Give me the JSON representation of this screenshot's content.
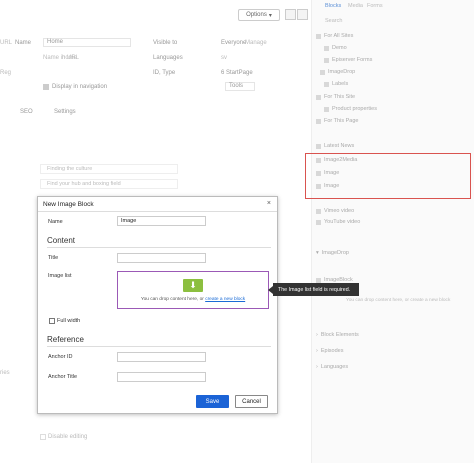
{
  "background": {
    "options_label": "Options",
    "fields": {
      "name_label": "Name",
      "name_value": "Home",
      "name_url_label": "Name in URL",
      "name_url_value": "home",
      "visible_label": "Visible to",
      "visible_value": "Everyone",
      "visible_link": "Manage",
      "languages_label": "Languages",
      "languages_value": "sv",
      "id_type_label": "ID, Type",
      "id_type_value": "6 StartPage",
      "display_nav_label": "Display in navigation",
      "tools_label": "Tools",
      "seo_tab": "SEO",
      "settings_tab": "Settings"
    },
    "cards": [
      "Finding the culture",
      "Find your hub and boxing field"
    ],
    "partial_left_1": "URL",
    "partial_left_2": "Reg",
    "partial_left_3": "ries",
    "bottom_checkbox_label": "Disable editing"
  },
  "right_panel": {
    "tabs": [
      "Blocks",
      "Media",
      "Forms"
    ],
    "search_placeholder": "Search",
    "tree": [
      "For All Sites",
      "Demo",
      "Episerver Forms",
      "ImageDrop",
      "Labels",
      "For This Site",
      "Product properties",
      "For This Page"
    ],
    "list_a": [
      "Latest News",
      "Image2Media",
      "Image",
      "Image"
    ],
    "list_b": [
      "Vimeo video",
      "YouTube video"
    ],
    "imagedrop_header": "ImageDrop",
    "imagedrop_item": "ImageBlock",
    "drop_hint": "You can drop content here, or create a new block",
    "sections": [
      "Block Elements",
      "Episodes",
      "Languages"
    ]
  },
  "modal": {
    "title": "New Image Block",
    "close_icon": "×",
    "name_label": "Name",
    "name_value": "Image",
    "content_heading": "Content",
    "title_label": "Title",
    "image_list_label": "Image list",
    "drop_text_prefix": "You can drop content here, or ",
    "drop_link": "create a new block",
    "full_width_label": "Full width",
    "reference_heading": "Reference",
    "anchor_id_label": "Anchor ID",
    "anchor_title_label": "Anchor Title",
    "save_label": "Save",
    "cancel_label": "Cancel"
  },
  "tooltip": "The Image list field is required.",
  "colors": {
    "primary": "#1b63d6",
    "dropzone_border": "#9b59b6",
    "drop_icon": "#8cbf3f",
    "highlight": "#d9534f"
  }
}
